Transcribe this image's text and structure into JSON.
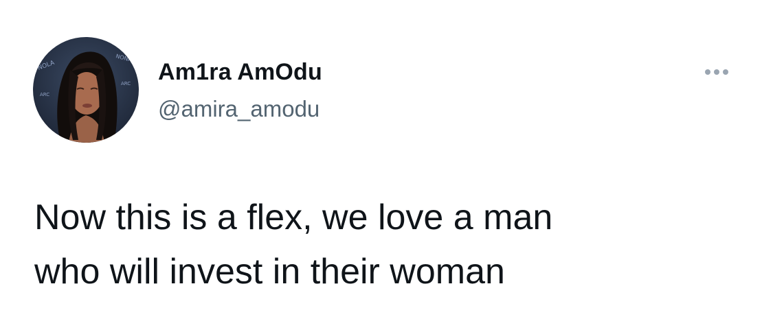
{
  "author": {
    "display_name": "Am1ra AmOdu",
    "handle": "@amira_amodu",
    "avatar_icon": "profile-photo"
  },
  "menu": {
    "icon": "more-horizontal-icon"
  },
  "tweet": {
    "lines": [
      "Now this is a flex, we love a man",
      "who will invest in their woman"
    ]
  },
  "colors": {
    "text_primary": "#0f1419",
    "text_secondary": "#536471",
    "menu_dots": "#9aa5b1",
    "background": "#ffffff"
  }
}
